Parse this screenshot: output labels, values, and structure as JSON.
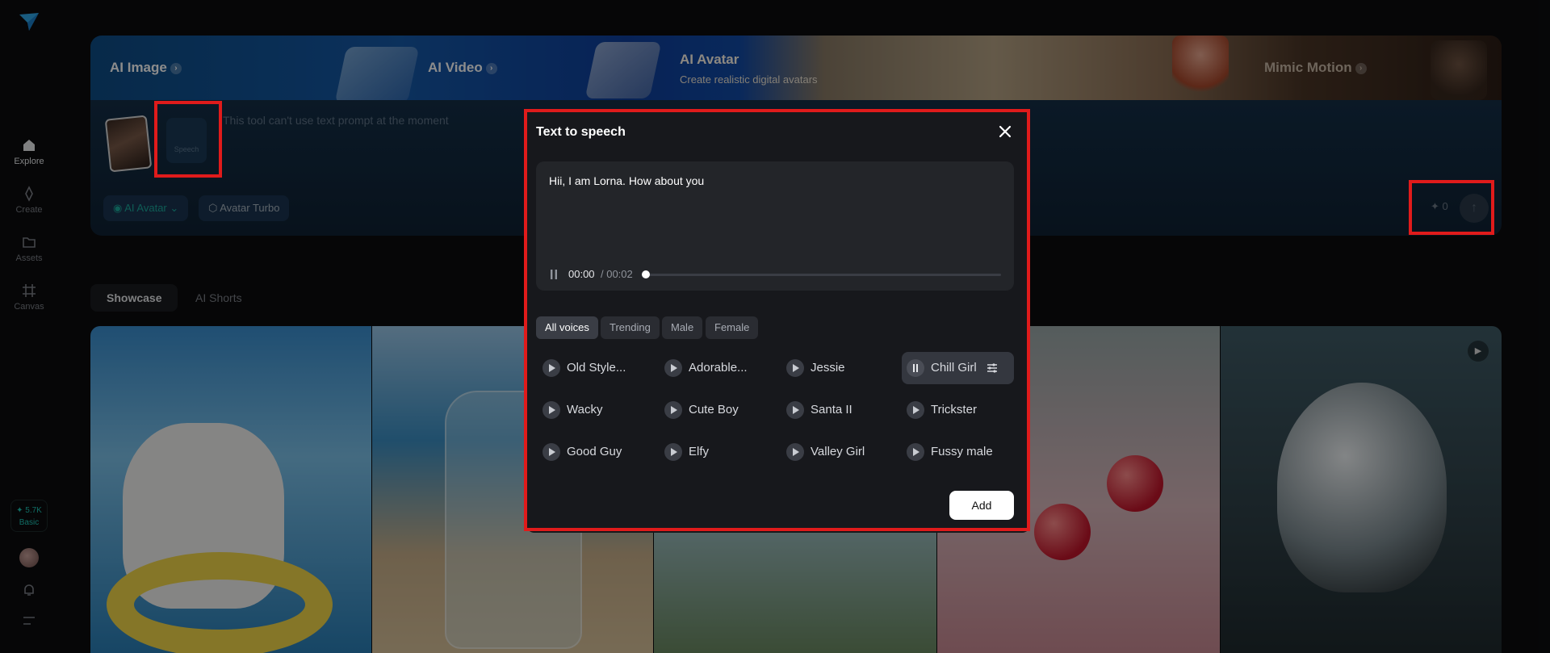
{
  "sidebar": {
    "items": [
      {
        "label": "Explore",
        "icon": "home-icon"
      },
      {
        "label": "Create",
        "icon": "sparkle-icon"
      },
      {
        "label": "Assets",
        "icon": "folder-icon"
      },
      {
        "label": "Canvas",
        "icon": "canvas-icon"
      }
    ],
    "credits": {
      "amount": "✦ 5.7K",
      "plan": "Basic"
    }
  },
  "banner": {
    "items": [
      {
        "label": "AI Image"
      },
      {
        "label": "AI Video"
      },
      {
        "label": "AI Avatar",
        "subtitle": "Create realistic digital avatars"
      },
      {
        "label": "Mimic Motion"
      }
    ]
  },
  "prompt": {
    "speech_tile_label": "Speech",
    "hint": "This tool can't use text prompt at the moment",
    "mode_chip": "AI Avatar",
    "model_chip": "Avatar Turbo",
    "credit_cost": "✦ 0"
  },
  "tabs": [
    {
      "label": "Showcase",
      "active": true
    },
    {
      "label": "AI Shorts",
      "active": false
    }
  ],
  "modal": {
    "title": "Text to speech",
    "text": "Hii, I am Lorna. How about you",
    "player": {
      "current": "00:00",
      "total": "/ 00:02",
      "progress": 0.0
    },
    "filters": [
      {
        "label": "All voices",
        "active": true
      },
      {
        "label": "Trending",
        "active": false
      },
      {
        "label": "Male",
        "active": false
      },
      {
        "label": "Female",
        "active": false
      }
    ],
    "voices": [
      {
        "name": "Old Style...",
        "selected": false
      },
      {
        "name": "Adorable...",
        "selected": false
      },
      {
        "name": "Jessie",
        "selected": false
      },
      {
        "name": "Chill Girl",
        "selected": true
      },
      {
        "name": "Wacky",
        "selected": false
      },
      {
        "name": "Cute Boy",
        "selected": false
      },
      {
        "name": "Santa II",
        "selected": false
      },
      {
        "name": "Trickster",
        "selected": false
      },
      {
        "name": "Good Guy",
        "selected": false
      },
      {
        "name": "Elfy",
        "selected": false
      },
      {
        "name": "Valley Girl",
        "selected": false
      },
      {
        "name": "Fussy male",
        "selected": false
      }
    ],
    "add_label": "Add"
  },
  "colors": {
    "accent": "#1ec6b6",
    "highlight": "#e01b1b",
    "modal_bg": "#17181c"
  }
}
